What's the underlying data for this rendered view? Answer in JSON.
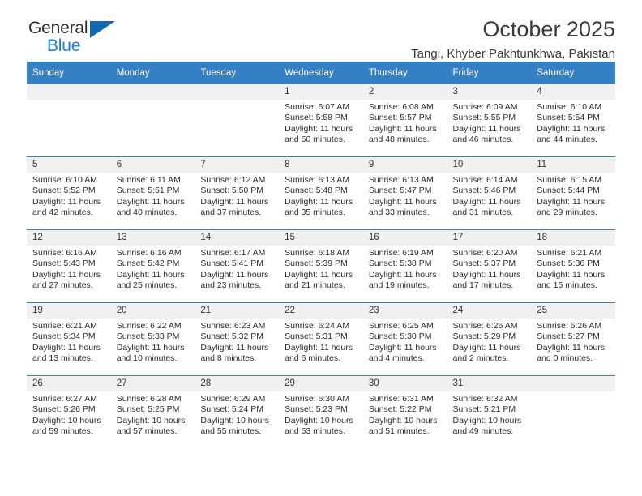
{
  "brand": {
    "name_top": "General",
    "name_bottom": "Blue",
    "accent_color": "#1266b2",
    "blue_text_color": "#1b7fd4"
  },
  "header": {
    "title": "October 2025",
    "subtitle": "Tangi, Khyber Pakhtunkhwa, Pakistan"
  },
  "theme": {
    "header_row_color": "#3580c4",
    "daynum_band_color": "#f0f0f0",
    "grid_line_color": "#3580c4"
  },
  "weekday_headers": [
    "Sunday",
    "Monday",
    "Tuesday",
    "Wednesday",
    "Thursday",
    "Friday",
    "Saturday"
  ],
  "weeks": [
    [
      {
        "day": "",
        "sunrise": "",
        "sunset": "",
        "daylight_line1": "",
        "daylight_line2": ""
      },
      {
        "day": "",
        "sunrise": "",
        "sunset": "",
        "daylight_line1": "",
        "daylight_line2": ""
      },
      {
        "day": "",
        "sunrise": "",
        "sunset": "",
        "daylight_line1": "",
        "daylight_line2": ""
      },
      {
        "day": "1",
        "sunrise": "Sunrise: 6:07 AM",
        "sunset": "Sunset: 5:58 PM",
        "daylight_line1": "Daylight: 11 hours",
        "daylight_line2": "and 50 minutes."
      },
      {
        "day": "2",
        "sunrise": "Sunrise: 6:08 AM",
        "sunset": "Sunset: 5:57 PM",
        "daylight_line1": "Daylight: 11 hours",
        "daylight_line2": "and 48 minutes."
      },
      {
        "day": "3",
        "sunrise": "Sunrise: 6:09 AM",
        "sunset": "Sunset: 5:55 PM",
        "daylight_line1": "Daylight: 11 hours",
        "daylight_line2": "and 46 minutes."
      },
      {
        "day": "4",
        "sunrise": "Sunrise: 6:10 AM",
        "sunset": "Sunset: 5:54 PM",
        "daylight_line1": "Daylight: 11 hours",
        "daylight_line2": "and 44 minutes."
      }
    ],
    [
      {
        "day": "5",
        "sunrise": "Sunrise: 6:10 AM",
        "sunset": "Sunset: 5:52 PM",
        "daylight_line1": "Daylight: 11 hours",
        "daylight_line2": "and 42 minutes."
      },
      {
        "day": "6",
        "sunrise": "Sunrise: 6:11 AM",
        "sunset": "Sunset: 5:51 PM",
        "daylight_line1": "Daylight: 11 hours",
        "daylight_line2": "and 40 minutes."
      },
      {
        "day": "7",
        "sunrise": "Sunrise: 6:12 AM",
        "sunset": "Sunset: 5:50 PM",
        "daylight_line1": "Daylight: 11 hours",
        "daylight_line2": "and 37 minutes."
      },
      {
        "day": "8",
        "sunrise": "Sunrise: 6:13 AM",
        "sunset": "Sunset: 5:48 PM",
        "daylight_line1": "Daylight: 11 hours",
        "daylight_line2": "and 35 minutes."
      },
      {
        "day": "9",
        "sunrise": "Sunrise: 6:13 AM",
        "sunset": "Sunset: 5:47 PM",
        "daylight_line1": "Daylight: 11 hours",
        "daylight_line2": "and 33 minutes."
      },
      {
        "day": "10",
        "sunrise": "Sunrise: 6:14 AM",
        "sunset": "Sunset: 5:46 PM",
        "daylight_line1": "Daylight: 11 hours",
        "daylight_line2": "and 31 minutes."
      },
      {
        "day": "11",
        "sunrise": "Sunrise: 6:15 AM",
        "sunset": "Sunset: 5:44 PM",
        "daylight_line1": "Daylight: 11 hours",
        "daylight_line2": "and 29 minutes."
      }
    ],
    [
      {
        "day": "12",
        "sunrise": "Sunrise: 6:16 AM",
        "sunset": "Sunset: 5:43 PM",
        "daylight_line1": "Daylight: 11 hours",
        "daylight_line2": "and 27 minutes."
      },
      {
        "day": "13",
        "sunrise": "Sunrise: 6:16 AM",
        "sunset": "Sunset: 5:42 PM",
        "daylight_line1": "Daylight: 11 hours",
        "daylight_line2": "and 25 minutes."
      },
      {
        "day": "14",
        "sunrise": "Sunrise: 6:17 AM",
        "sunset": "Sunset: 5:41 PM",
        "daylight_line1": "Daylight: 11 hours",
        "daylight_line2": "and 23 minutes."
      },
      {
        "day": "15",
        "sunrise": "Sunrise: 6:18 AM",
        "sunset": "Sunset: 5:39 PM",
        "daylight_line1": "Daylight: 11 hours",
        "daylight_line2": "and 21 minutes."
      },
      {
        "day": "16",
        "sunrise": "Sunrise: 6:19 AM",
        "sunset": "Sunset: 5:38 PM",
        "daylight_line1": "Daylight: 11 hours",
        "daylight_line2": "and 19 minutes."
      },
      {
        "day": "17",
        "sunrise": "Sunrise: 6:20 AM",
        "sunset": "Sunset: 5:37 PM",
        "daylight_line1": "Daylight: 11 hours",
        "daylight_line2": "and 17 minutes."
      },
      {
        "day": "18",
        "sunrise": "Sunrise: 6:21 AM",
        "sunset": "Sunset: 5:36 PM",
        "daylight_line1": "Daylight: 11 hours",
        "daylight_line2": "and 15 minutes."
      }
    ],
    [
      {
        "day": "19",
        "sunrise": "Sunrise: 6:21 AM",
        "sunset": "Sunset: 5:34 PM",
        "daylight_line1": "Daylight: 11 hours",
        "daylight_line2": "and 13 minutes."
      },
      {
        "day": "20",
        "sunrise": "Sunrise: 6:22 AM",
        "sunset": "Sunset: 5:33 PM",
        "daylight_line1": "Daylight: 11 hours",
        "daylight_line2": "and 10 minutes."
      },
      {
        "day": "21",
        "sunrise": "Sunrise: 6:23 AM",
        "sunset": "Sunset: 5:32 PM",
        "daylight_line1": "Daylight: 11 hours",
        "daylight_line2": "and 8 minutes."
      },
      {
        "day": "22",
        "sunrise": "Sunrise: 6:24 AM",
        "sunset": "Sunset: 5:31 PM",
        "daylight_line1": "Daylight: 11 hours",
        "daylight_line2": "and 6 minutes."
      },
      {
        "day": "23",
        "sunrise": "Sunrise: 6:25 AM",
        "sunset": "Sunset: 5:30 PM",
        "daylight_line1": "Daylight: 11 hours",
        "daylight_line2": "and 4 minutes."
      },
      {
        "day": "24",
        "sunrise": "Sunrise: 6:26 AM",
        "sunset": "Sunset: 5:29 PM",
        "daylight_line1": "Daylight: 11 hours",
        "daylight_line2": "and 2 minutes."
      },
      {
        "day": "25",
        "sunrise": "Sunrise: 6:26 AM",
        "sunset": "Sunset: 5:27 PM",
        "daylight_line1": "Daylight: 11 hours",
        "daylight_line2": "and 0 minutes."
      }
    ],
    [
      {
        "day": "26",
        "sunrise": "Sunrise: 6:27 AM",
        "sunset": "Sunset: 5:26 PM",
        "daylight_line1": "Daylight: 10 hours",
        "daylight_line2": "and 59 minutes."
      },
      {
        "day": "27",
        "sunrise": "Sunrise: 6:28 AM",
        "sunset": "Sunset: 5:25 PM",
        "daylight_line1": "Daylight: 10 hours",
        "daylight_line2": "and 57 minutes."
      },
      {
        "day": "28",
        "sunrise": "Sunrise: 6:29 AM",
        "sunset": "Sunset: 5:24 PM",
        "daylight_line1": "Daylight: 10 hours",
        "daylight_line2": "and 55 minutes."
      },
      {
        "day": "29",
        "sunrise": "Sunrise: 6:30 AM",
        "sunset": "Sunset: 5:23 PM",
        "daylight_line1": "Daylight: 10 hours",
        "daylight_line2": "and 53 minutes."
      },
      {
        "day": "30",
        "sunrise": "Sunrise: 6:31 AM",
        "sunset": "Sunset: 5:22 PM",
        "daylight_line1": "Daylight: 10 hours",
        "daylight_line2": "and 51 minutes."
      },
      {
        "day": "31",
        "sunrise": "Sunrise: 6:32 AM",
        "sunset": "Sunset: 5:21 PM",
        "daylight_line1": "Daylight: 10 hours",
        "daylight_line2": "and 49 minutes."
      },
      {
        "day": "",
        "sunrise": "",
        "sunset": "",
        "daylight_line1": "",
        "daylight_line2": ""
      }
    ]
  ]
}
